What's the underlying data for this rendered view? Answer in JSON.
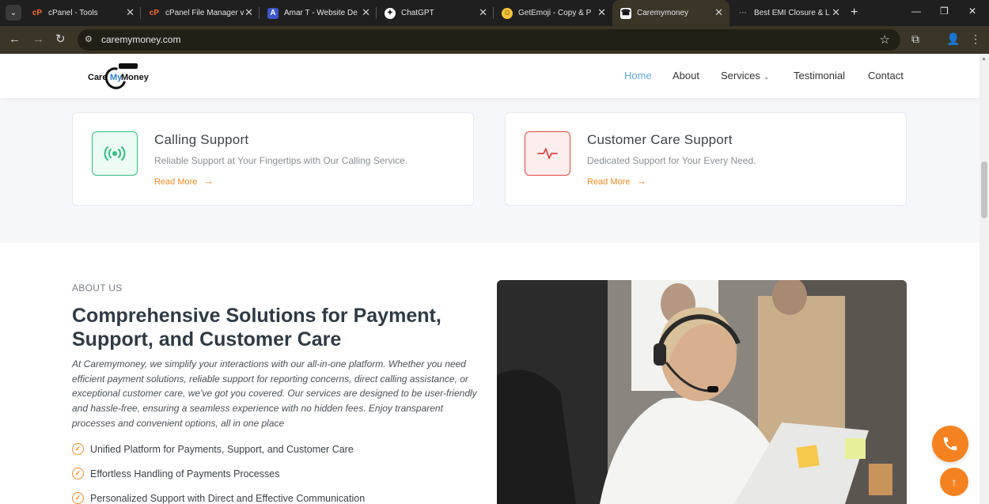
{
  "browser": {
    "tabs": [
      {
        "title": "cPanel - Tools",
        "favicon": "cpanel-icon",
        "color": "#ff6c2c"
      },
      {
        "title": "cPanel File Manager v",
        "favicon": "cpanel-icon",
        "color": "#ff6c2c"
      },
      {
        "title": "Amar T - Website De",
        "favicon": "app-icon",
        "color": "#3c55c8"
      },
      {
        "title": "ChatGPT",
        "favicon": "chatgpt-icon",
        "color": "#ffffff"
      },
      {
        "title": "GetEmoji - Copy & P",
        "favicon": "emoji-icon",
        "color": "#f5c33b"
      },
      {
        "title": "Caremymoney",
        "favicon": "caremymoney-icon",
        "color": "#ffffff"
      },
      {
        "title": "Best EMI Closure & L",
        "favicon": "loading-icon",
        "color": "#888888"
      }
    ],
    "active_tab_index": 5,
    "url": "caremymoney.com"
  },
  "header": {
    "logo": {
      "care": "Care",
      "my": "My",
      "money": "Money"
    },
    "nav": [
      {
        "label": "Home",
        "active": true
      },
      {
        "label": "About",
        "active": false
      },
      {
        "label": "Services",
        "active": false,
        "has_dropdown": true
      },
      {
        "label": "Testimonial",
        "active": false
      },
      {
        "label": "Contact",
        "active": false
      }
    ]
  },
  "services": [
    {
      "title": "Calling Support",
      "desc": "Reliable Support at Your Fingertips with Our Calling Service.",
      "link": "Read More",
      "icon": "broadcast-icon",
      "accent": "#2fbf7f"
    },
    {
      "title": "Customer Care Support",
      "desc": "Dedicated Support for Your Every Need.",
      "link": "Read More",
      "icon": "pulse-icon",
      "accent": "#e0473f"
    }
  ],
  "about": {
    "eyebrow": "ABOUT US",
    "title": "Comprehensive Solutions for Payment, Support, and Customer Care",
    "desc": "At Caremymoney, we simplify your interactions with our all-in-one platform. Whether you need efficient payment solutions, reliable support for reporting concerns, direct calling assistance, or exceptional customer care, we've got you covered. Our services are designed to be user-friendly and hassle-free, ensuring a seamless experience with no hidden fees. Enjoy transparent processes and convenient options, all in one place",
    "features": [
      "Unified Platform for Payments, Support, and Customer Care",
      "Effortless Handling of Payments Processes",
      "Personalized Support with Direct and Effective Communication"
    ]
  },
  "colors": {
    "accent": "#f58220",
    "nav_active": "#5fa8d8",
    "heading": "#2f3a44"
  }
}
